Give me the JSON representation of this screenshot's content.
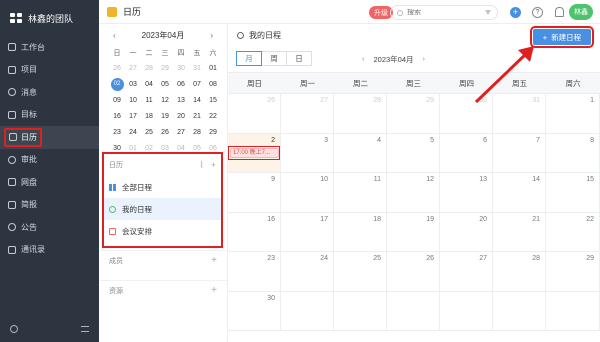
{
  "sidebar": {
    "team_name": "林鑫的团队",
    "items": [
      {
        "label": "工作台",
        "icon": "dashboard-icon"
      },
      {
        "label": "项目",
        "icon": "project-icon"
      },
      {
        "label": "消息",
        "icon": "message-icon"
      },
      {
        "label": "目标",
        "icon": "target-icon"
      },
      {
        "label": "日历",
        "icon": "calendar-icon",
        "active": true
      },
      {
        "label": "审批",
        "icon": "approval-icon"
      },
      {
        "label": "网盘",
        "icon": "cloud-drive-icon"
      },
      {
        "label": "简报",
        "icon": "report-icon"
      },
      {
        "label": "公告",
        "icon": "announcement-icon"
      },
      {
        "label": "通讯录",
        "icon": "contacts-icon"
      }
    ]
  },
  "header": {
    "title": "日历",
    "upgrade_label": "升级",
    "search_placeholder": "搜索",
    "avatar_text": "林鑫"
  },
  "mini_calendar": {
    "month_label": "2023年04月",
    "prev": "‹",
    "next": "›",
    "weekdays": [
      "日",
      "一",
      "二",
      "三",
      "四",
      "五",
      "六"
    ],
    "rows": [
      [
        {
          "d": "26",
          "dim": true
        },
        {
          "d": "27",
          "dim": true
        },
        {
          "d": "28",
          "dim": true
        },
        {
          "d": "29",
          "dim": true
        },
        {
          "d": "30",
          "dim": true
        },
        {
          "d": "31",
          "dim": true
        },
        {
          "d": "01"
        }
      ],
      [
        {
          "d": "02",
          "today": true
        },
        {
          "d": "03"
        },
        {
          "d": "04"
        },
        {
          "d": "05"
        },
        {
          "d": "06"
        },
        {
          "d": "07"
        },
        {
          "d": "08"
        }
      ],
      [
        {
          "d": "09"
        },
        {
          "d": "10"
        },
        {
          "d": "11"
        },
        {
          "d": "12"
        },
        {
          "d": "13"
        },
        {
          "d": "14"
        },
        {
          "d": "15"
        }
      ],
      [
        {
          "d": "16"
        },
        {
          "d": "17"
        },
        {
          "d": "18"
        },
        {
          "d": "19"
        },
        {
          "d": "20"
        },
        {
          "d": "21"
        },
        {
          "d": "22"
        }
      ],
      [
        {
          "d": "23"
        },
        {
          "d": "24"
        },
        {
          "d": "25"
        },
        {
          "d": "26"
        },
        {
          "d": "27"
        },
        {
          "d": "28"
        },
        {
          "d": "29"
        }
      ],
      [
        {
          "d": "30"
        },
        {
          "d": "01",
          "dim": true
        },
        {
          "d": "02",
          "dim": true
        },
        {
          "d": "03",
          "dim": true
        },
        {
          "d": "04",
          "dim": true
        },
        {
          "d": "05",
          "dim": true
        },
        {
          "d": "06",
          "dim": true
        }
      ]
    ]
  },
  "calendars": {
    "heading": "日历",
    "items": [
      {
        "label": "全部日程",
        "icon": "grid"
      },
      {
        "label": "我的日程",
        "icon": "user",
        "selected": true
      },
      {
        "label": "会议安排",
        "icon": "cal"
      }
    ]
  },
  "members_label": "成员",
  "resources_label": "资源",
  "main": {
    "top_label": "我的日程",
    "new_button": "新建日程",
    "views": [
      "月",
      "周",
      "日"
    ],
    "month_label": "2023年04月",
    "weekdays": [
      "周日",
      "周一",
      "周二",
      "周三",
      "周四",
      "周五",
      "周六"
    ],
    "rows": [
      [
        {
          "d": "26",
          "dim": true
        },
        {
          "d": "27",
          "dim": true
        },
        {
          "d": "28",
          "dim": true
        },
        {
          "d": "29",
          "dim": true
        },
        {
          "d": "30",
          "dim": true
        },
        {
          "d": "31",
          "dim": true
        },
        {
          "d": "1"
        }
      ],
      [
        {
          "d": "2",
          "today": true,
          "event": "17:00 晚上7..."
        },
        {
          "d": "3"
        },
        {
          "d": "4"
        },
        {
          "d": "5"
        },
        {
          "d": "6"
        },
        {
          "d": "7"
        },
        {
          "d": "8"
        }
      ],
      [
        {
          "d": "9"
        },
        {
          "d": "10"
        },
        {
          "d": "11"
        },
        {
          "d": "12"
        },
        {
          "d": "13"
        },
        {
          "d": "14"
        },
        {
          "d": "15"
        }
      ],
      [
        {
          "d": "16"
        },
        {
          "d": "17"
        },
        {
          "d": "18"
        },
        {
          "d": "19"
        },
        {
          "d": "20"
        },
        {
          "d": "21"
        },
        {
          "d": "22"
        }
      ],
      [
        {
          "d": "23"
        },
        {
          "d": "24"
        },
        {
          "d": "25"
        },
        {
          "d": "26"
        },
        {
          "d": "27"
        },
        {
          "d": "28"
        },
        {
          "d": "29"
        }
      ],
      [
        {
          "d": "30"
        },
        {
          "d": ""
        },
        {
          "d": ""
        },
        {
          "d": ""
        },
        {
          "d": ""
        },
        {
          "d": ""
        },
        {
          "d": ""
        }
      ]
    ]
  },
  "colors": {
    "sidebar_bg": "#2d3540",
    "accent": "#4a90e2",
    "highlight": "#e02020",
    "today_bg": "#fdf3e7"
  }
}
